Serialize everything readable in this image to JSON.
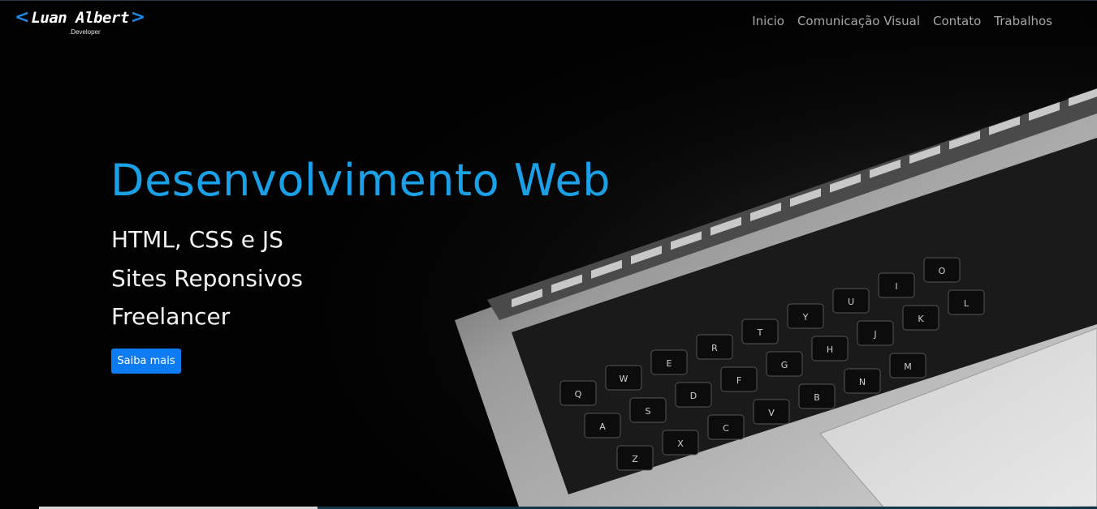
{
  "brand": {
    "name": "Luan Albert",
    "subtitle": ".Developer",
    "bracket_left": "<",
    "bracket_right": ">",
    "accent": "#1e88e5"
  },
  "nav": {
    "items": [
      {
        "label": "Inicio"
      },
      {
        "label": "Comunicação Visual"
      },
      {
        "label": "Contato"
      },
      {
        "label": "Trabalhos"
      }
    ]
  },
  "hero": {
    "title": "Desenvolvimento Web",
    "lines": [
      "HTML, CSS e JS",
      "Sites Reponsivos",
      "Freelancer"
    ],
    "cta_label": "Saiba mais",
    "title_color": "#1aa0e6",
    "cta_color": "#0d7cf2"
  },
  "keyboard": {
    "row1": [
      "Q",
      "W",
      "E",
      "R",
      "T",
      "Y",
      "U",
      "I",
      "O"
    ],
    "row2": [
      "A",
      "S",
      "D",
      "F",
      "G",
      "H",
      "J",
      "K",
      "L"
    ],
    "row3": [
      "Z",
      "X",
      "C",
      "V",
      "B",
      "N",
      "M"
    ]
  }
}
